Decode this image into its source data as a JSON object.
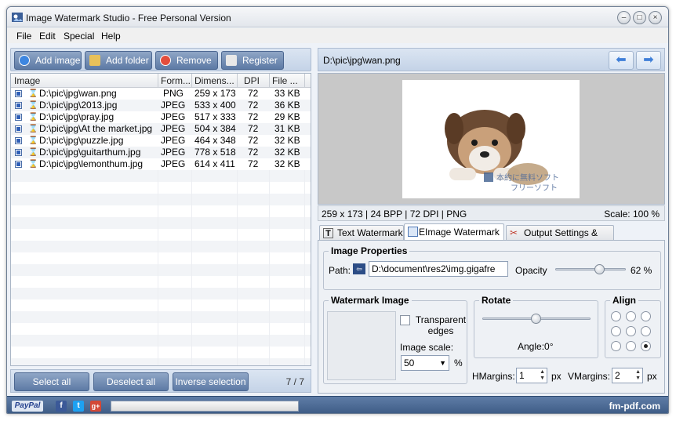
{
  "window": {
    "title": "Image Watermark Studio - Free Personal Version"
  },
  "menu": [
    "File",
    "Edit",
    "Special",
    "Help"
  ],
  "toolbar": {
    "add_image": "Add image",
    "add_folder": "Add folder",
    "remove": "Remove",
    "register": "Register"
  },
  "grid": {
    "columns": [
      "Image",
      "Form...",
      "Dimens...",
      "DPI",
      "File ..."
    ],
    "rows": [
      {
        "path": "D:\\pic\\jpg\\wan.png",
        "format": "PNG",
        "dims": "259 x 173",
        "dpi": "72",
        "size": "33 KB"
      },
      {
        "path": "D:\\pic\\jpg\\2013.jpg",
        "format": "JPEG",
        "dims": "533 x 400",
        "dpi": "72",
        "size": "36 KB"
      },
      {
        "path": "D:\\pic\\jpg\\pray.jpg",
        "format": "JPEG",
        "dims": "517 x 333",
        "dpi": "72",
        "size": "29 KB"
      },
      {
        "path": "D:\\pic\\jpg\\At the market.jpg",
        "format": "JPEG",
        "dims": "504 x 384",
        "dpi": "72",
        "size": "31 KB"
      },
      {
        "path": "D:\\pic\\jpg\\puzzle.jpg",
        "format": "JPEG",
        "dims": "464 x 348",
        "dpi": "72",
        "size": "32 KB"
      },
      {
        "path": "D:\\pic\\jpg\\guitarthum.jpg",
        "format": "JPEG",
        "dims": "778 x 518",
        "dpi": "72",
        "size": "32 KB"
      },
      {
        "path": "D:\\pic\\jpg\\lemonthum.jpg",
        "format": "JPEG",
        "dims": "614 x 411",
        "dpi": "72",
        "size": "32 KB"
      }
    ]
  },
  "bottom": {
    "select_all": "Select all",
    "deselect_all": "Deselect all",
    "inverse": "Inverse selection",
    "count": "7 / 7"
  },
  "preview": {
    "path": "D:\\pic\\jpg\\wan.png",
    "info": "259 x 173  |  24 BPP  |  72 DPI  |  PNG",
    "scale": "Scale: 100 %",
    "watermark_line1": "本約に無料ソフト",
    "watermark_line2": "フリーソフト"
  },
  "tabs": [
    "Text Watermark",
    "EImage Watermark",
    "Output Settings & Start"
  ],
  "props": {
    "title": "Image Properties",
    "path_label": "Path:",
    "path_value": "D:\\document\\res2\\img.gigafre",
    "opacity_label": "Opacity",
    "opacity_value": "62 %",
    "opacity": 0.62
  },
  "wm": {
    "title": "Watermark Image",
    "transparent_edges": "Transparent edges",
    "scale_label": "Image scale:",
    "scale_value": "50",
    "scale_unit": "%"
  },
  "rotate": {
    "title": "Rotate",
    "angle": "Angle:0°"
  },
  "align": {
    "title": "Align"
  },
  "margins": {
    "h_label": "HMargins:",
    "h_value": "1",
    "h_unit": "px",
    "v_label": "VMargins:",
    "v_value": "2",
    "v_unit": "px"
  },
  "status": {
    "paypal": "PayPal",
    "brand": "fm-pdf.com"
  }
}
